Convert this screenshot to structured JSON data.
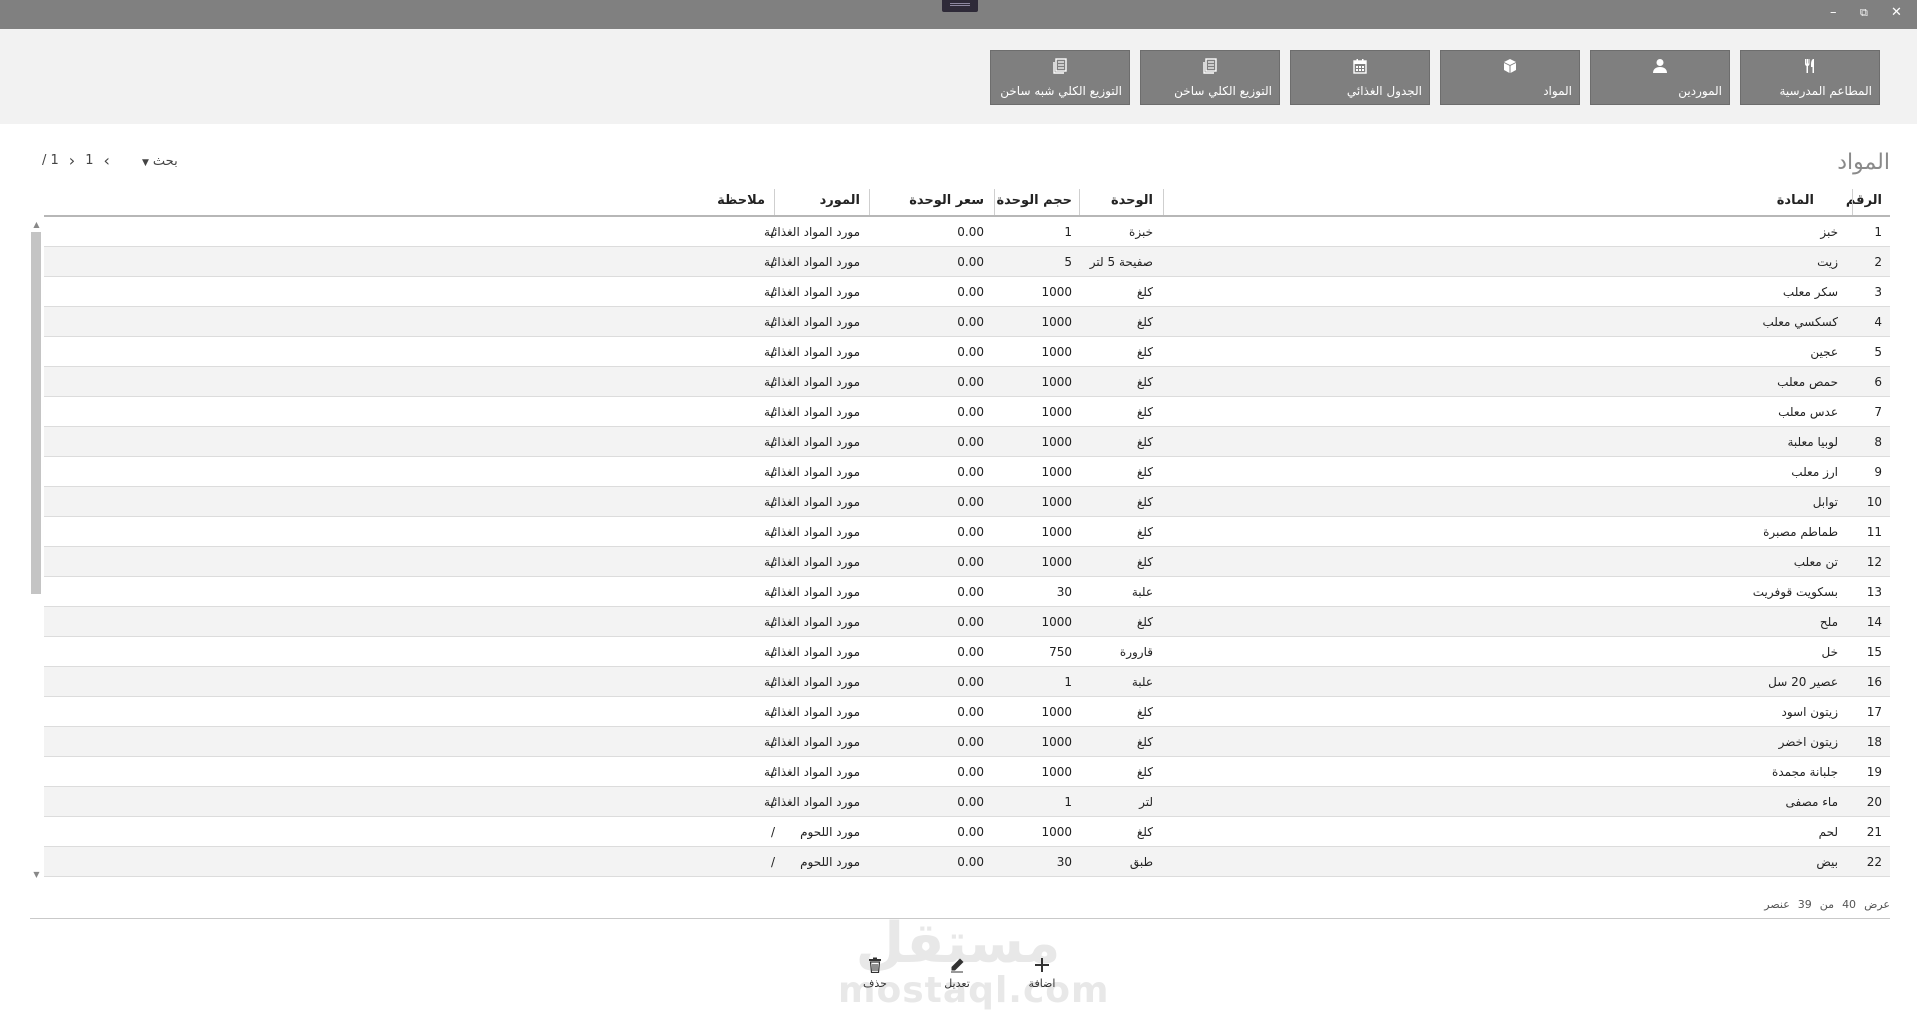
{
  "window": {
    "minimize": "–",
    "restore": "⧉",
    "close": "✕"
  },
  "toolbar": {
    "buttons": [
      {
        "label": "المطاعم المدرسية",
        "icon": "cutlery-icon"
      },
      {
        "label": "الموردين",
        "icon": "user-icon"
      },
      {
        "label": "المواد",
        "icon": "box-icon"
      },
      {
        "label": "الجدول الغذائي",
        "icon": "calendar-icon"
      },
      {
        "label": "التوزيع الكلي ساخن",
        "icon": "report-icon"
      },
      {
        "label": "التوزيع الكلي شبه ساخن",
        "icon": "report-icon"
      }
    ]
  },
  "page": {
    "title": "المواد"
  },
  "search": {
    "label": "بحث"
  },
  "pager": {
    "current": "1",
    "total": "/ 1"
  },
  "table": {
    "headers": {
      "num": "الرقم",
      "name": "المادة",
      "unit": "الوحدة",
      "size": "حجم الوحدة",
      "price": "سعر الوحدة",
      "supplier": "المورد",
      "note": "ملاحظة"
    },
    "rows": [
      {
        "num": "1",
        "name": "خبز",
        "unit": "خبزة",
        "size": "1",
        "price": "0.00",
        "supplier": "مورد المواد الغذائية",
        "note": "/"
      },
      {
        "num": "2",
        "name": "زيت",
        "unit": "صفيحة 5 لتر",
        "size": "5",
        "price": "0.00",
        "supplier": "مورد المواد الغذائية",
        "note": "/"
      },
      {
        "num": "3",
        "name": "سكر معلب",
        "unit": "كلغ",
        "size": "1000",
        "price": "0.00",
        "supplier": "مورد المواد الغذائية",
        "note": "/"
      },
      {
        "num": "4",
        "name": "كسكسي معلب",
        "unit": "كلغ",
        "size": "1000",
        "price": "0.00",
        "supplier": "مورد المواد الغذائية",
        "note": "/"
      },
      {
        "num": "5",
        "name": "عجين",
        "unit": "كلغ",
        "size": "1000",
        "price": "0.00",
        "supplier": "مورد المواد الغذائية",
        "note": "/"
      },
      {
        "num": "6",
        "name": "حمص معلب",
        "unit": "كلغ",
        "size": "1000",
        "price": "0.00",
        "supplier": "مورد المواد الغذائية",
        "note": "/"
      },
      {
        "num": "7",
        "name": "عدس معلب",
        "unit": "كلغ",
        "size": "1000",
        "price": "0.00",
        "supplier": "مورد المواد الغذائية",
        "note": "/"
      },
      {
        "num": "8",
        "name": "لوبيا معلبة",
        "unit": "كلغ",
        "size": "1000",
        "price": "0.00",
        "supplier": "مورد المواد الغذائية",
        "note": "/"
      },
      {
        "num": "9",
        "name": "ارز معلب",
        "unit": "كلغ",
        "size": "1000",
        "price": "0.00",
        "supplier": "مورد المواد الغذائية",
        "note": "/"
      },
      {
        "num": "10",
        "name": "توابل",
        "unit": "كلغ",
        "size": "1000",
        "price": "0.00",
        "supplier": "مورد المواد الغذائية",
        "note": "/"
      },
      {
        "num": "11",
        "name": "طماطم مصبرة",
        "unit": "كلغ",
        "size": "1000",
        "price": "0.00",
        "supplier": "مورد المواد الغذائية",
        "note": "/"
      },
      {
        "num": "12",
        "name": "تن معلب",
        "unit": "كلغ",
        "size": "1000",
        "price": "0.00",
        "supplier": "مورد المواد الغذائية",
        "note": "/"
      },
      {
        "num": "13",
        "name": "بسكويت قوفريت",
        "unit": "علبة",
        "size": "30",
        "price": "0.00",
        "supplier": "مورد المواد الغذائية",
        "note": "/"
      },
      {
        "num": "14",
        "name": "ملح",
        "unit": "كلغ",
        "size": "1000",
        "price": "0.00",
        "supplier": "مورد المواد الغذائية",
        "note": "/"
      },
      {
        "num": "15",
        "name": "خل",
        "unit": "قارورة",
        "size": "750",
        "price": "0.00",
        "supplier": "مورد المواد الغذائية",
        "note": "/"
      },
      {
        "num": "16",
        "name": "عصير 20 سل",
        "unit": "علبة",
        "size": "1",
        "price": "0.00",
        "supplier": "مورد المواد الغذائية",
        "note": "/"
      },
      {
        "num": "17",
        "name": "زيتون اسود",
        "unit": "كلغ",
        "size": "1000",
        "price": "0.00",
        "supplier": "مورد المواد الغذائية",
        "note": "/"
      },
      {
        "num": "18",
        "name": "زيتون اخضر",
        "unit": "كلغ",
        "size": "1000",
        "price": "0.00",
        "supplier": "مورد المواد الغذائية",
        "note": "/"
      },
      {
        "num": "19",
        "name": "جلبانة مجمدة",
        "unit": "كلغ",
        "size": "1000",
        "price": "0.00",
        "supplier": "مورد المواد الغذائية",
        "note": "/"
      },
      {
        "num": "20",
        "name": "ماء مصفى",
        "unit": "لتر",
        "size": "1",
        "price": "0.00",
        "supplier": "مورد المواد الغذائية",
        "note": "/"
      },
      {
        "num": "21",
        "name": "لحم",
        "unit": "كلغ",
        "size": "1000",
        "price": "0.00",
        "supplier": "مورد اللحوم",
        "note": "/"
      },
      {
        "num": "22",
        "name": "بيض",
        "unit": "طبق",
        "size": "30",
        "price": "0.00",
        "supplier": "مورد اللحوم",
        "note": "/"
      }
    ]
  },
  "footer": {
    "show_label": "عرض",
    "show_value": "40",
    "of_label": "من",
    "total_value": "39",
    "items_label": "عنصر"
  },
  "actions": {
    "add": "اضافة",
    "edit": "تعديل",
    "delete": "حذف"
  },
  "watermark": {
    "arabic": "مستقل",
    "latin": "mostaql.com"
  }
}
